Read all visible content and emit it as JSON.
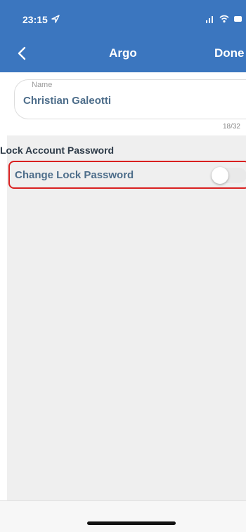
{
  "status_bar": {
    "time": "23:15",
    "icons": [
      "location-arrow-icon",
      "signal-icon",
      "wifi-icon",
      "battery-icon"
    ]
  },
  "nav": {
    "back_icon": "chevron-left-icon",
    "title": "Argo",
    "done_label": "Done"
  },
  "name_field": {
    "label": "Name",
    "value": "Christian Galeotti",
    "counter": "18/32"
  },
  "lock_section": {
    "header": "Lock Account Password",
    "toggle_label": "Change Lock Password",
    "toggle_on": false,
    "highlight_color": "#d92020"
  },
  "colors": {
    "header": "#3b76bf",
    "background": "#efefef",
    "label_text": "#4d6d8a"
  }
}
